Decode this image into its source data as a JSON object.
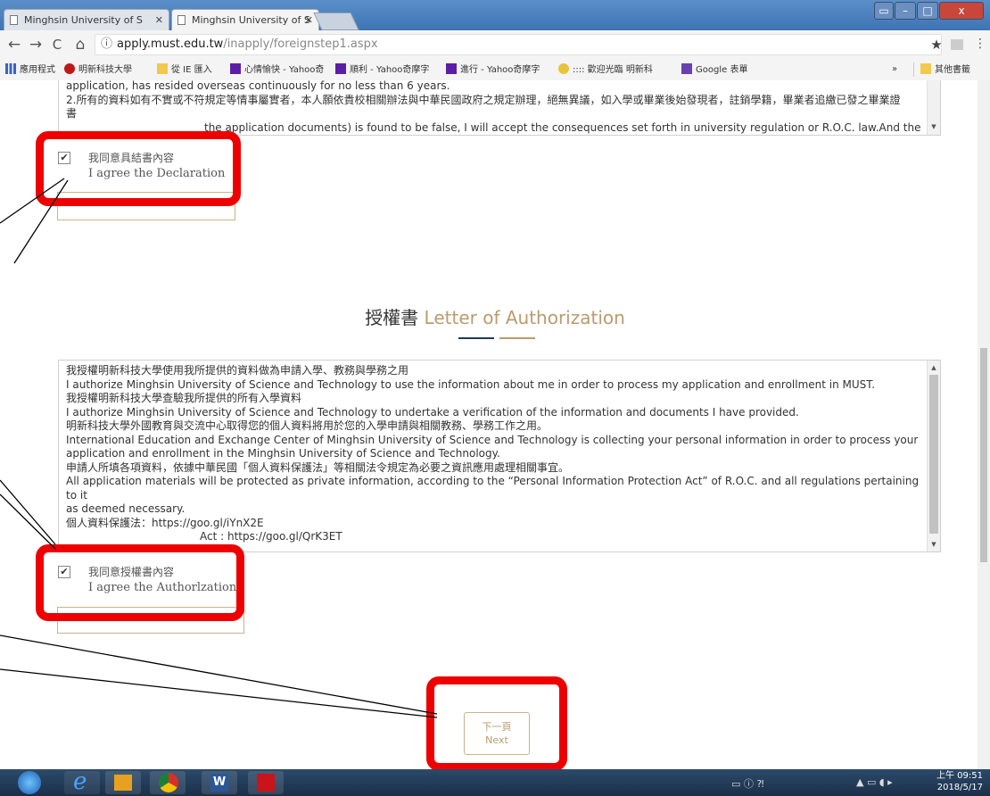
{
  "browser": {
    "tabs": [
      {
        "label": "Minghsin University of S"
      },
      {
        "label": "Minghsin University of S"
      }
    ],
    "window_controls": {
      "restore": "▭",
      "minimize": "–",
      "maximize": "□",
      "close": "x"
    },
    "nav": {
      "back": "←",
      "forward": "→",
      "reload": "C",
      "home": "⌂"
    },
    "url": {
      "host": "apply.must.edu.tw",
      "path": "/inapply/foreignstep1.aspx"
    },
    "star_icon": "★",
    "bookmarks": [
      {
        "label": "應用程式",
        "icon": "apps-grid-icon",
        "color": "#3a62c9"
      },
      {
        "label": "明新科技大學",
        "icon": "school-logo-icon",
        "color": "#c01818"
      },
      {
        "label": "從 IE 匯入",
        "icon": "folder-icon",
        "color": "#f2c94c"
      },
      {
        "label": "心情愉快 - Yahoo奇",
        "icon": "yahoo-icon",
        "color": "#5b1ea6"
      },
      {
        "label": "順利 - Yahoo奇摩字",
        "icon": "yahoo-icon",
        "color": "#5b1ea6"
      },
      {
        "label": "進行 - Yahoo奇摩字",
        "icon": "yahoo-icon",
        "color": "#5b1ea6"
      },
      {
        "label": ":::: 歡迎光臨 明新科",
        "icon": "emoji-icon",
        "color": "#e8c33a"
      },
      {
        "label": "Google 表單",
        "icon": "google-forms-icon",
        "color": "#6a3fb0"
      }
    ],
    "bookmarks_overflow": "»",
    "other_bookmarks": "其他書籤"
  },
  "declaration": {
    "lines": [
      "application, has resided overseas continuously for no less than 6 years.",
      "2.所有的資料如有不實或不符規定等情事屬實者，本人願依貴校相關辦法與中華民國政府之規定辦理，絕無異議，如入學或畢業後始發現者，註銷學籍，畢業者追繳已發之畢業證",
      "書",
      "the application documents) is found to be false, I will accept the consequences set forth in university regulation or R.O.C. law.And the"
    ],
    "agree_zh": "我同意具結書內容",
    "agree_en": "I agree the Declaration",
    "checked_mark": "✔"
  },
  "authorization": {
    "title_zh": "授權書",
    "title_en": "Letter of Authorization",
    "lines": [
      "我授權明新科技大學使用我所提供的資料做為申請入學、教務與學務之用",
      "I authorize Minghsin University of Science and Technology to use the information about me in order to process my application and enrollment in MUST.",
      "我授權明新科技大學查驗我所提供的所有入學資料",
      "I authorize Minghsin University of Science and Technology to undertake a verification of the information and documents I have provided.",
      "明新科技大學外國教育與交流中心取得您的個人資料將用於您的入學申請與相關教務、學務工作之用。",
      "International Education and Exchange Center of Minghsin University of Science and Technology is collecting your personal information in order to process your",
      "application and enrollment in the Minghsin University of Science and Technology.",
      "申請人所填各項資料，依據中華民國「個人資料保護法」等相關法令規定為必要之資訊應用處理相關事宜。",
      "All application materials will be protected as private information, according to the “Personal Information Protection Act” of R.O.C. and all regulations pertaining to it",
      "as deemed necessary.",
      "個人資料保護法：https://goo.gl/iYnX2E",
      "Act : https://goo.gl/QrK3ET"
    ],
    "agree_zh": "我同意授權書內容",
    "agree_en": "I agree the Authorlzation",
    "checked_mark": "✔"
  },
  "next_button": {
    "zh": "下一頁",
    "en": "Next"
  },
  "taskbar": {
    "apps": [
      {
        "icon": "windows-start-icon",
        "color": "#3a8ee6"
      },
      {
        "icon": "internet-explorer-icon",
        "color": "#2f7fd6"
      },
      {
        "icon": "outlook-icon",
        "color": "#e8a020"
      },
      {
        "icon": "chrome-icon",
        "color": "#d93025"
      },
      {
        "icon": "word-icon",
        "color": "#2b579a"
      },
      {
        "icon": "acrobat-icon",
        "color": "#c8141a"
      }
    ],
    "time": "上午 09:51",
    "date": "2018/5/17"
  },
  "colors": {
    "highlight": "#ee0000",
    "gold": "#b89c6d",
    "navy": "#1f3a5f"
  }
}
